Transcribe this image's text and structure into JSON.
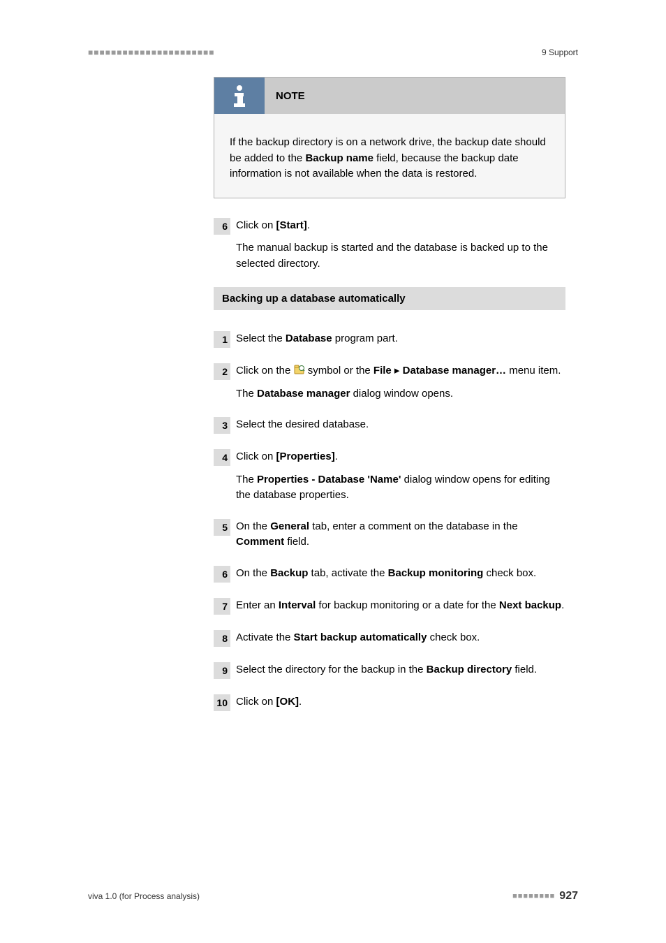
{
  "header": {
    "left_marks": "■■■■■■■■■■■■■■■■■■■■■■",
    "right": "9 Support"
  },
  "note": {
    "title": "NOTE",
    "body_parts": [
      "If the backup directory is on a network drive, the backup date should be added to the ",
      "Backup name",
      " field, because the backup date information is not available when the data is restored."
    ]
  },
  "step6a": {
    "num": "6",
    "line1_pre": "Click on ",
    "line1_bold": "[Start]",
    "line1_post": ".",
    "line2": "The manual backup is started and the database is backed up to the selected directory."
  },
  "section_heading": "Backing up a database automatically",
  "auto": {
    "s1": {
      "num": "1",
      "pre": "Select the ",
      "b": "Database",
      "post": " program part."
    },
    "s2": {
      "num": "2",
      "pre": "Click on the ",
      "mid": " symbol or the ",
      "b1": "File",
      "arrow": " ▸ ",
      "b2": "Database manager…",
      "post": " menu item.",
      "line2_pre": "The ",
      "line2_b": "Database manager",
      "line2_post": " dialog window opens."
    },
    "s3": {
      "num": "3",
      "text": "Select the desired database."
    },
    "s4": {
      "num": "4",
      "l1_pre": "Click on ",
      "l1_b": "[Properties]",
      "l1_post": ".",
      "l2_pre": "The ",
      "l2_b": "Properties - Database 'Name'",
      "l2_post": " dialog window opens for editing the database properties."
    },
    "s5": {
      "num": "5",
      "pre": "On the ",
      "b1": "General",
      "mid": " tab, enter a comment on the database in the ",
      "b2": "Comment",
      "post": " field."
    },
    "s6": {
      "num": "6",
      "pre": "On the ",
      "b1": "Backup",
      "mid": " tab, activate the ",
      "b2": "Backup monitoring",
      "post": " check box."
    },
    "s7": {
      "num": "7",
      "pre": "Enter an ",
      "b1": "Interval",
      "mid": " for backup monitoring or a date for the ",
      "b2": "Next backup",
      "post": "."
    },
    "s8": {
      "num": "8",
      "pre": "Activate the ",
      "b": "Start backup automatically",
      "post": " check box."
    },
    "s9": {
      "num": "9",
      "pre": "Select the directory for the backup in the ",
      "b": "Backup directory",
      "post": " field."
    },
    "s10": {
      "num": "10",
      "pre": "Click on ",
      "b": "[OK]",
      "post": "."
    }
  },
  "footer": {
    "left": "viva 1.0 (for Process analysis)",
    "marks": "■■■■■■■■",
    "page": "927"
  }
}
